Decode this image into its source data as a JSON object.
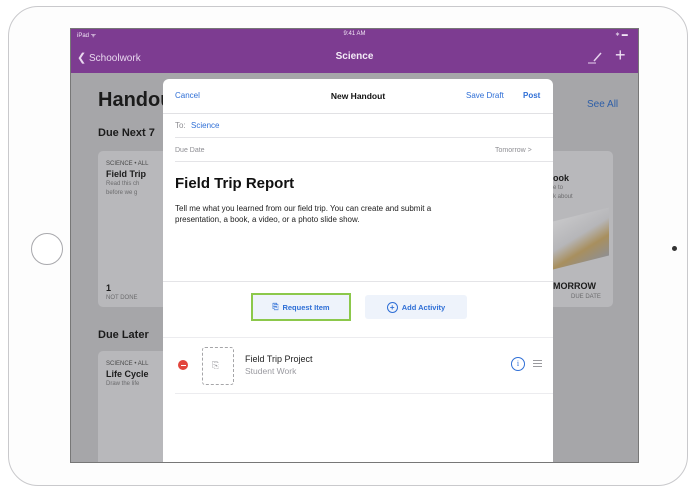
{
  "status_bar": {
    "left": "iPad ᯤ",
    "time": "9:41 AM",
    "right": "∗ ▬"
  },
  "app": {
    "back_label": "Schoolwork",
    "title": "Science"
  },
  "background": {
    "heading": "Handouts",
    "see_all": "See All",
    "due_next_label": "Due Next 7",
    "due_later_label": "Due Later",
    "card1": {
      "subject": "SCIENCE • ALL",
      "title": "Field Trip",
      "desc1": "Read this ch",
      "desc2": "before we g",
      "count": "1",
      "status": "NOT DONE"
    },
    "card2": {
      "title": "ook",
      "desc1": "e to",
      "desc2": "k about",
      "due": "MORROW",
      "due_label": "DUE DATE"
    },
    "card3": {
      "subject": "SCIENCE • ALL",
      "title": "Life Cycle",
      "desc": "Draw the life"
    }
  },
  "modal": {
    "cancel": "Cancel",
    "title": "New Handout",
    "save_draft": "Save Draft",
    "post": "Post",
    "to_label": "To:",
    "to_value": "Science",
    "due_label": "Due Date",
    "due_value": "Tomorrow  >",
    "handout_title": "Field Trip Report",
    "handout_body": "Tell me what you learned from our field trip. You can create and submit a presentation, a book, a video, or a photo slide show.",
    "request_item": "Request Item",
    "add_activity": "Add Activity",
    "item_title": "Field Trip Project",
    "item_subtitle": "Student Work"
  },
  "colors": {
    "app_bar": "#7d3c91",
    "accent": "#2f6fd6",
    "highlight": "#8cc84b",
    "delete": "#e2453c"
  }
}
